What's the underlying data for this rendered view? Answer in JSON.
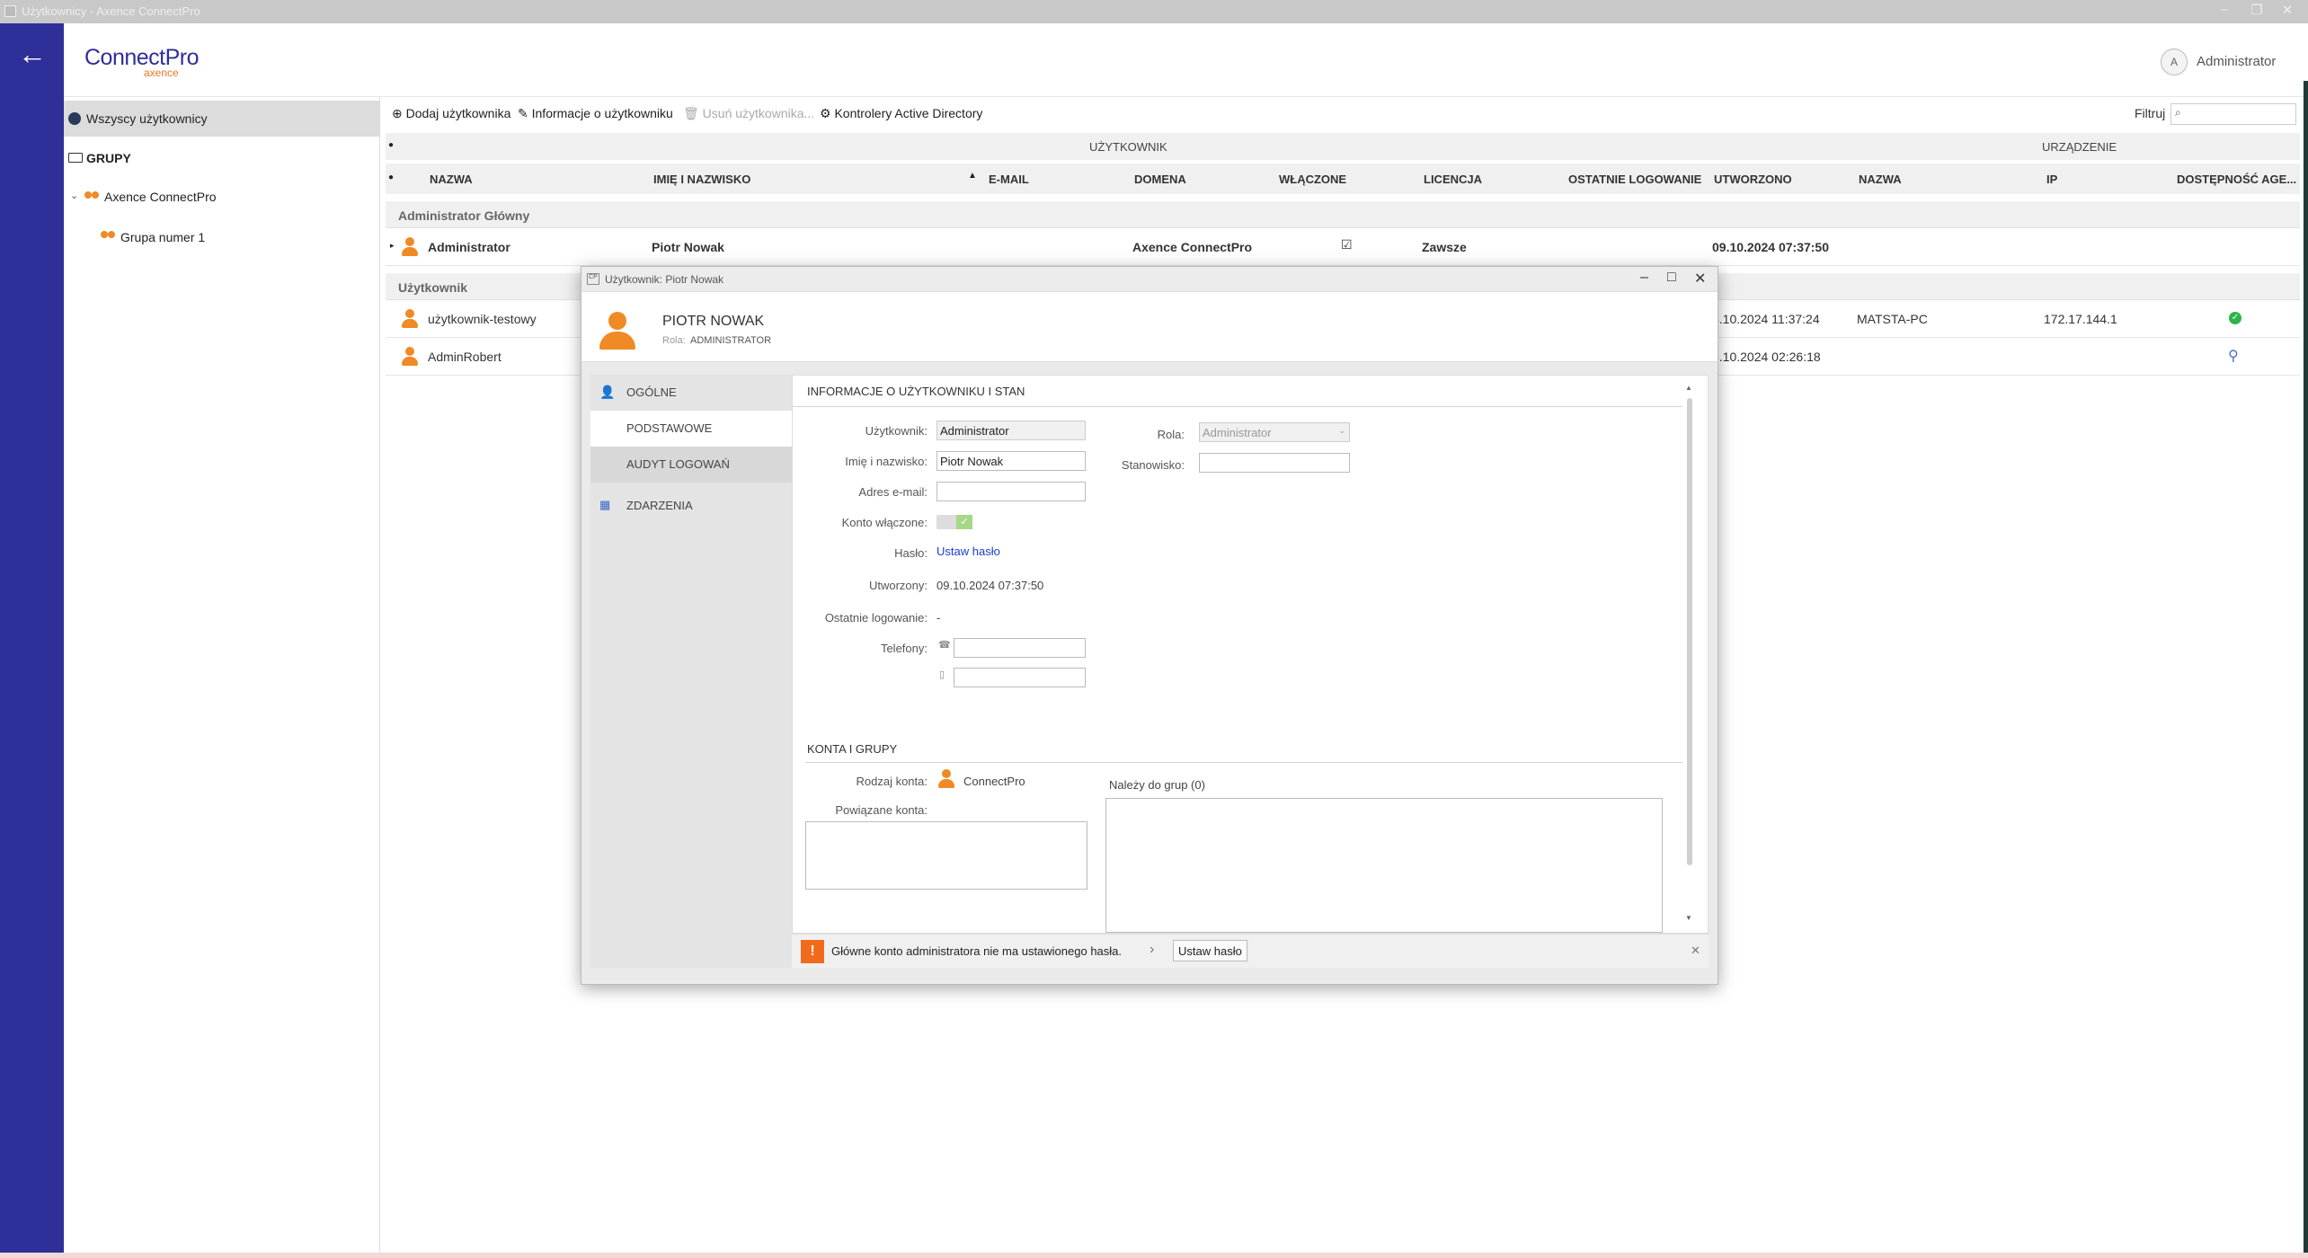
{
  "window": {
    "title": "Użytkownicy - Axence ConnectPro",
    "icon": "app-icon"
  },
  "header": {
    "logo_main": "ConnectPro",
    "logo_sub": "axence",
    "avatar_letter": "A",
    "user_name": "Administrator"
  },
  "sidebar": {
    "all_users": "Wszyscy użytkownicy",
    "groups_title": "GRUPY",
    "tree": [
      {
        "label": "Axence ConnectPro"
      },
      {
        "label": "Grupa numer 1"
      }
    ]
  },
  "toolbar": {
    "add": "Dodaj użytkownika",
    "info": "Informacje o użytkowniku",
    "delete": "Usuń użytkownika...",
    "ad": "Kontrolery Active Directory",
    "filter_label": "Filtruj"
  },
  "table": {
    "group_headers": {
      "user": "UŻYTKOWNIK",
      "device": "URZĄDZENIE"
    },
    "columns": [
      "NAZWA",
      "IMIĘ I NAZWISKO",
      "E-MAIL",
      "DOMENA",
      "WŁĄCZONE",
      "LICENCJA",
      "OSTATNIE LOGOWANIE",
      "UTWORZONO",
      "NAZWA",
      "IP",
      "DOSTĘPNOŚĆ AGE..."
    ],
    "groups": [
      {
        "label": "Administrator Główny",
        "rows": [
          {
            "name": "Administrator",
            "fullname": "Piotr Nowak",
            "domain": "Axence ConnectPro",
            "enabled": true,
            "license": "Zawsze",
            "created": "09.10.2024 07:37:50"
          }
        ]
      },
      {
        "label": "Użytkownik",
        "rows": [
          {
            "name": "użytkownik-testowy",
            "created": "4.10.2024 11:37:24",
            "device": "MATSTA-PC",
            "ip": "172.17.144.1",
            "agent": "online"
          },
          {
            "name": "AdminRobert",
            "created": "5.10.2024 02:26:18",
            "agent": "plug"
          }
        ]
      }
    ]
  },
  "dialog": {
    "title": "Użytkownik: Piotr Nowak",
    "name": "PIOTR NOWAK",
    "role_label": "Rola:",
    "role": "ADMINISTRATOR",
    "nav": [
      {
        "label": "OGÓLNE"
      },
      {
        "label": "PODSTAWOWE"
      },
      {
        "label": "AUDYT LOGOWAŃ"
      },
      {
        "label": "ZDARZENIA"
      }
    ],
    "section1": "INFORMACJE O UŻYTKOWNIKU I STAN",
    "fields": {
      "user_label": "Użytkownik:",
      "user_value": "Administrator",
      "name_label": "Imię i nazwisko:",
      "name_value": "Piotr Nowak",
      "email_label": "Adres e-mail:",
      "email_value": "",
      "enabled_label": "Konto włączone:",
      "enabled": true,
      "password_label": "Hasło:",
      "password_link": "Ustaw hasło",
      "created_label": "Utworzony:",
      "created_value": "09.10.2024 07:37:50",
      "lastlogin_label": "Ostatnie logowanie:",
      "lastlogin_value": "-",
      "phones_label": "Telefony:",
      "role_label": "Rola:",
      "role_value": "Administrator",
      "position_label": "Stanowisko:",
      "position_value": ""
    },
    "section2": "KONTA I GRUPY",
    "accounts": {
      "type_label": "Rodzaj konta:",
      "type_value": "ConnectPro",
      "linked_label": "Powiązane konta:",
      "groups_label": "Należy do grup (0)"
    },
    "warning": {
      "text": "Główne konto administratora nie ma ustawionego hasła.",
      "button": "Ustaw hasło"
    }
  }
}
